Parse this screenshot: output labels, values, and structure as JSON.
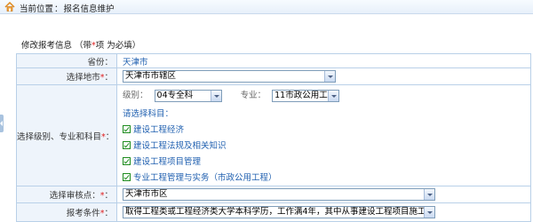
{
  "header": {
    "location_label": "当前位置",
    "separator": "：",
    "page_name": "报名信息维护"
  },
  "section": {
    "title_prefix": "修改报考信息 （带",
    "required_mark": "*",
    "title_suffix": "项 为必填）"
  },
  "form": {
    "province": {
      "label": "省份：",
      "value": "天津市"
    },
    "city": {
      "label": "选择地市",
      "required": "*",
      "colon": "：",
      "value": "天津市市辖区"
    },
    "level_major": {
      "label": "选择级别、专业和科目",
      "required": "*",
      "colon": "：",
      "level_label": "级别：",
      "level_value": "04专全科",
      "major_label": "专业：",
      "major_value": "11市政公用工程",
      "subjects_title": "请选择科目：",
      "subjects": [
        {
          "label": "建设工程经济",
          "checked": true
        },
        {
          "label": "建设工程法规及相关知识",
          "checked": true
        },
        {
          "label": "建设工程项目管理",
          "checked": true
        },
        {
          "label": "专业工程管理与实务（市政公用工程）",
          "checked": true
        }
      ]
    },
    "review_point": {
      "label": "选择审核点：",
      "required": "*",
      "colon": "：",
      "value": "天津市市区"
    },
    "condition": {
      "label": "报考条件",
      "required": "*",
      "colon": "：",
      "value": "取得工程类或工程经济类大学本科学历，工作满4年，其中从事建设工程项目施工管理"
    }
  },
  "colors": {
    "required": "#e02020",
    "label_bg": "#eef4fb",
    "border": "#b9d0e8",
    "accent_text": "#2060b0"
  }
}
